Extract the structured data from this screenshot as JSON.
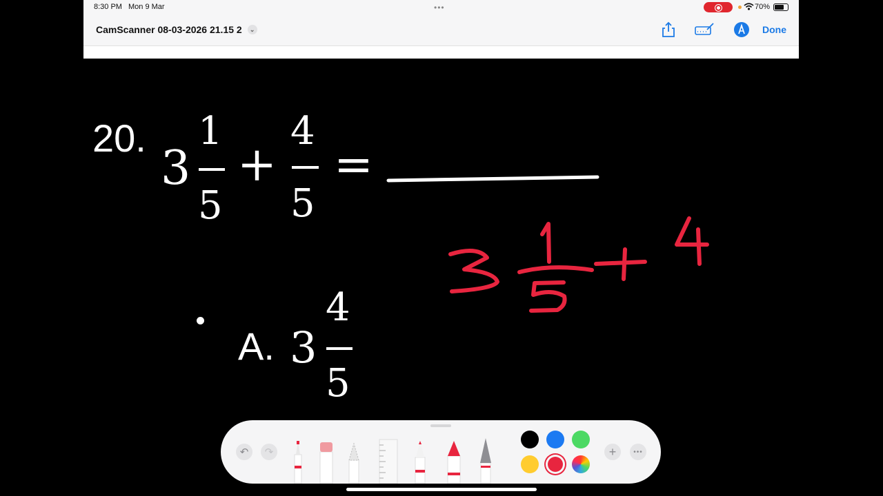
{
  "status_bar": {
    "time": "8:30 PM",
    "date": "Mon 9 Mar",
    "battery": "70%"
  },
  "document": {
    "title": "CamScanner 08-03-2026 21.15 2"
  },
  "toolbar": {
    "done_label": "Done"
  },
  "problem": {
    "number": "20.",
    "whole": "3",
    "num1": "1",
    "den1": "5",
    "plus": "+",
    "num2": "4",
    "den2": "5",
    "equals": "="
  },
  "option_a": {
    "label": "A.",
    "whole": "3",
    "num": "4",
    "den": "5"
  },
  "annotation": {
    "whole": "3",
    "num1": "1",
    "den1": "5",
    "plus": "+",
    "num2": "4",
    "color": "#e8253f"
  },
  "palette": {
    "colors": [
      "#000000",
      "#1c7af2",
      "#4cd964",
      "#ffcc2f",
      "#e8253f"
    ],
    "selected_color": "#e8253f"
  }
}
